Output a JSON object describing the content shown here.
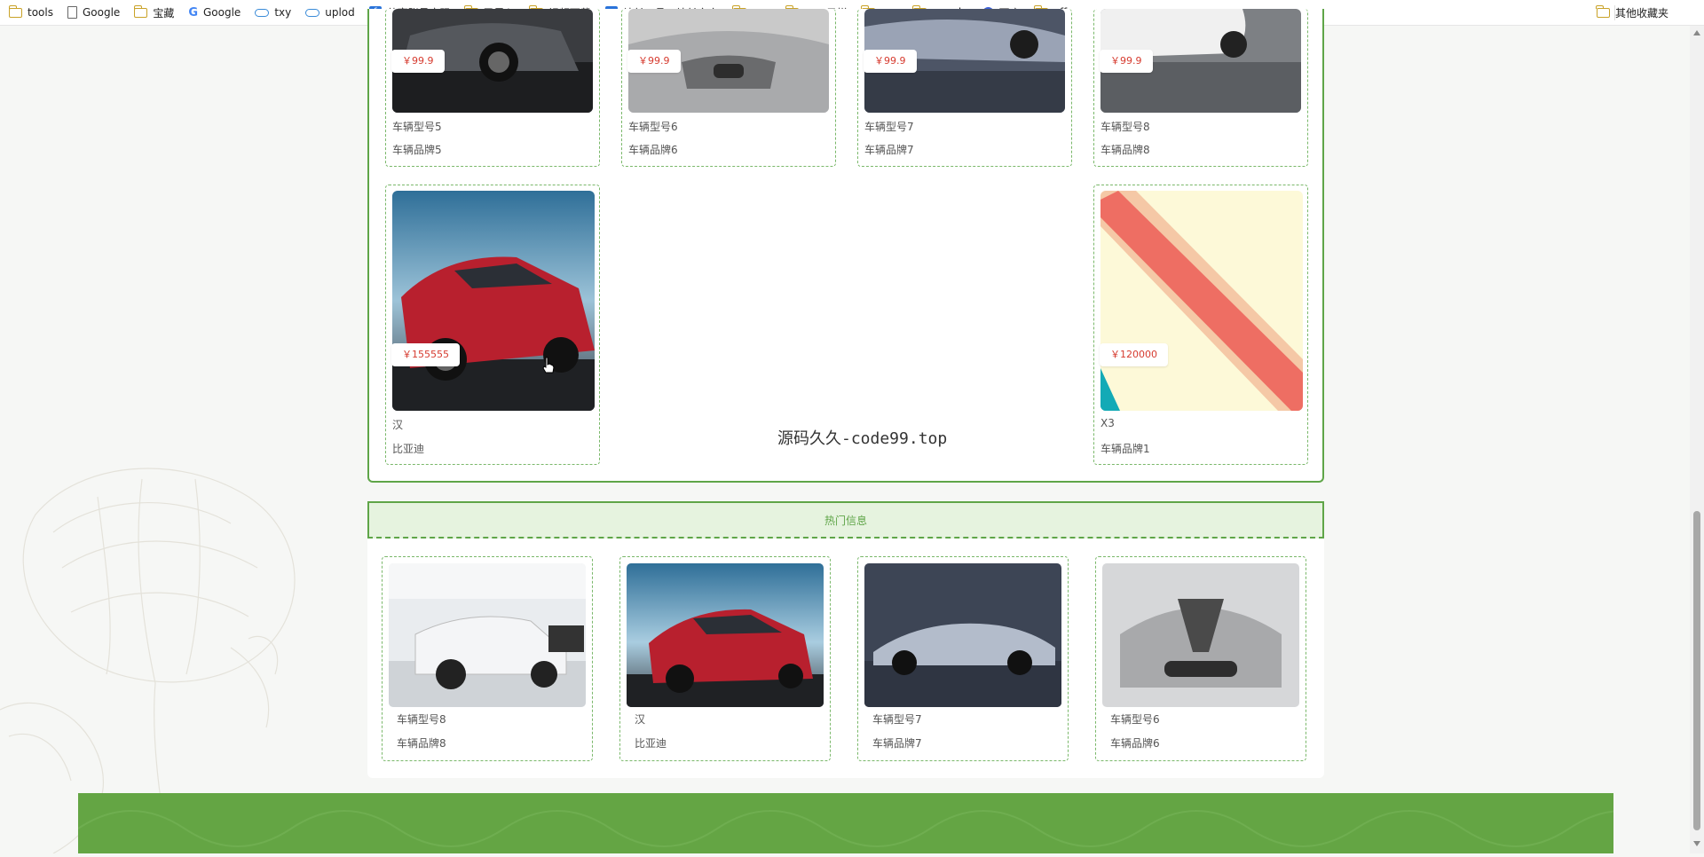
{
  "bookmarks": {
    "items": [
      {
        "label": "tools",
        "icon": "folder-icon"
      },
      {
        "label": "Google",
        "icon": "page-icon"
      },
      {
        "label": "宝藏",
        "icon": "folder-icon"
      },
      {
        "label": "Google",
        "icon": "google-icon"
      },
      {
        "label": "txy",
        "icon": "cloud-icon"
      },
      {
        "label": "uplod",
        "icon": "cloud-icon"
      },
      {
        "label": "共享账号密码",
        "icon": "app-icon"
      },
      {
        "label": "已导入",
        "icon": "folder-icon"
      },
      {
        "label": "视频下载",
        "icon": "folder-icon"
      },
      {
        "label": "站长工具 - 站长之家",
        "icon": "app-icon"
      },
      {
        "label": "vpn",
        "icon": "folder-icon"
      },
      {
        "label": "Max云梯",
        "icon": "folder-icon"
      },
      {
        "label": "vps",
        "icon": "folder-icon"
      },
      {
        "label": "google",
        "icon": "folder-icon"
      },
      {
        "label": "百度",
        "icon": "paw-icon"
      },
      {
        "label": "aff",
        "icon": "folder-icon"
      }
    ],
    "other": "其他收藏夹"
  },
  "top_cards": [
    {
      "price": "￥99.9",
      "name": "车辆型号5",
      "brand": "车辆品牌5"
    },
    {
      "price": "￥99.9",
      "name": "车辆型号6",
      "brand": "车辆品牌6"
    },
    {
      "price": "￥99.9",
      "name": "车辆型号7",
      "brand": "车辆品牌7"
    },
    {
      "price": "￥99.9",
      "name": "车辆型号8",
      "brand": "车辆品牌8"
    },
    {
      "price": "￥155555",
      "name": "汉",
      "brand": "比亚迪"
    },
    {
      "price": "￥120000",
      "name": "X3",
      "brand": "车辆品牌1"
    }
  ],
  "watermark": "源码久久-code99.top",
  "hot": {
    "title": "热门信息",
    "items": [
      {
        "name": "车辆型号8",
        "brand": "车辆品牌8"
      },
      {
        "name": "汉",
        "brand": "比亚迪"
      },
      {
        "name": "车辆型号7",
        "brand": "车辆品牌7"
      },
      {
        "name": "车辆型号6",
        "brand": "车辆品牌6"
      }
    ]
  },
  "colors": {
    "accent": "#5fa548",
    "price": "#d63b2f",
    "footer": "#64a544"
  }
}
